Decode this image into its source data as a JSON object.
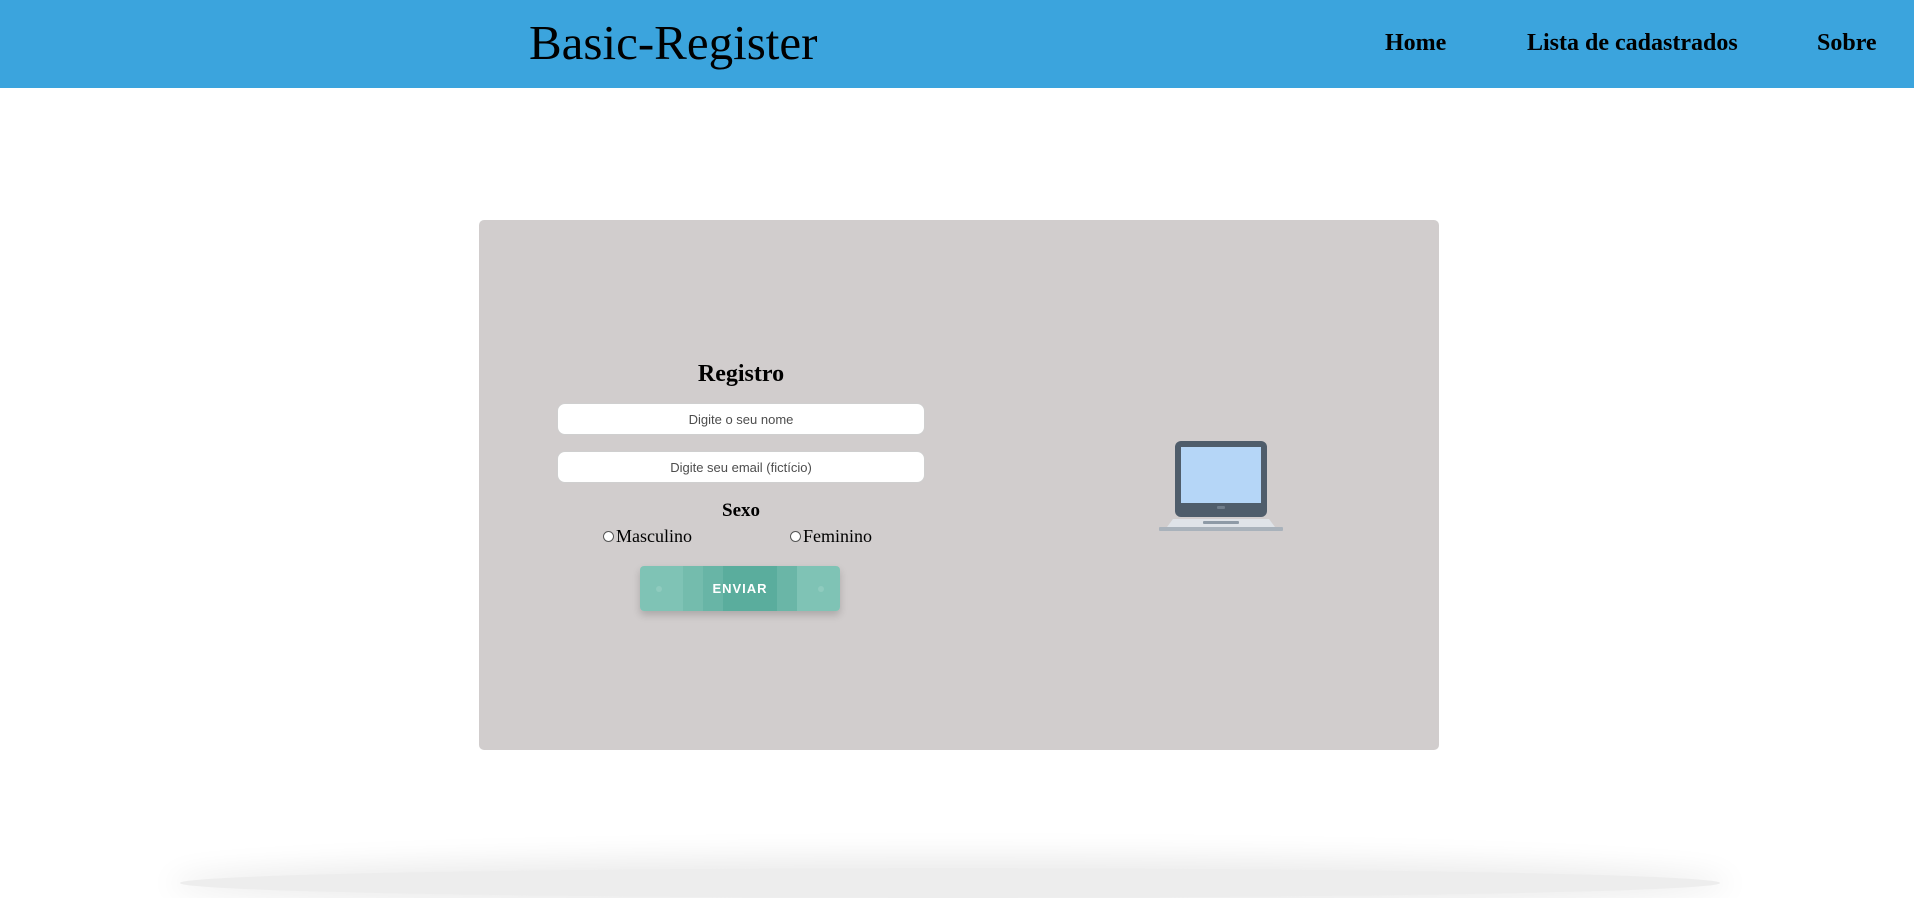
{
  "header": {
    "brand": "Basic-Register",
    "nav": {
      "home": "Home",
      "list": "Lista de cadastrados",
      "about": "Sobre"
    }
  },
  "form": {
    "title": "Registro",
    "name_placeholder": "Digite o seu nome",
    "email_placeholder": "Digite seu email (fictício)",
    "sex_label": "Sexo",
    "options": {
      "male": "Masculino",
      "female": "Feminino"
    },
    "submit_label": "ENVIAR"
  },
  "illustration": {
    "icon": "laptop-icon"
  },
  "colors": {
    "header_bg": "#3ba4dd",
    "card_bg": "#d1cdcd",
    "button": "#5aad9d",
    "laptop_screen": "#b5d6f7",
    "laptop_frame": "#4f5d6b"
  }
}
